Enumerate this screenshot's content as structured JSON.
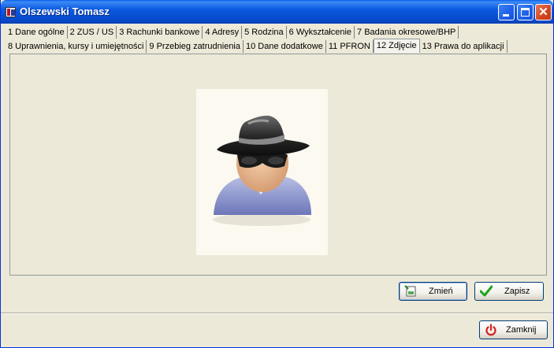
{
  "window": {
    "title": "Olszewski Tomasz"
  },
  "tabs_row1": [
    {
      "label": "1 Dane ogólne"
    },
    {
      "label": "2 ZUS / US"
    },
    {
      "label": "3 Rachunki bankowe"
    },
    {
      "label": "4 Adresy"
    },
    {
      "label": "5 Rodzina"
    },
    {
      "label": "6 Wykształcenie"
    },
    {
      "label": "7 Badania okresowe/BHP"
    }
  ],
  "tabs_row2": [
    {
      "label": "8 Uprawnienia, kursy i umiejętności"
    },
    {
      "label": "9 Przebieg zatrudnienia"
    },
    {
      "label": "10 Dane dodatkowe"
    },
    {
      "label": "11 PFRON"
    },
    {
      "label": "12 Zdjęcie",
      "active": true
    },
    {
      "label": "13 Prawa do aplikacji"
    }
  ],
  "photo": {
    "icon": "anonymous-person-hat-sunglasses"
  },
  "buttons": {
    "change_label": "Zmień",
    "save_label": "Zapisz",
    "close_label": "Zamknij"
  },
  "colors": {
    "titlebar": "#0A5AE0",
    "save_check": "#1FA21F",
    "close_power": "#D42020"
  }
}
